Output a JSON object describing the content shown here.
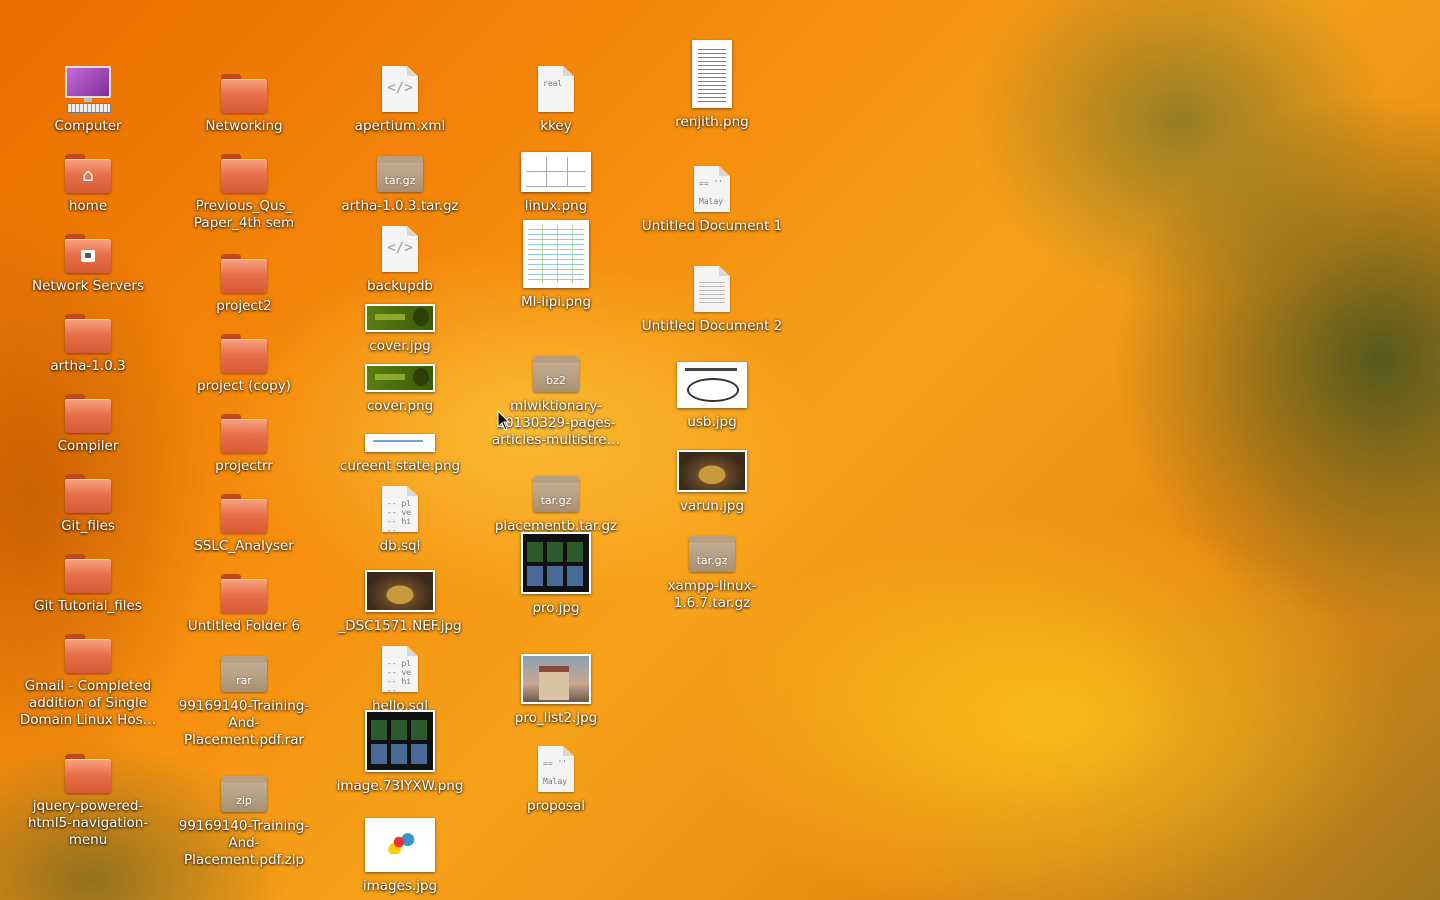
{
  "desktop": {
    "icons": [
      {
        "label": "Computer",
        "type": "computer"
      },
      {
        "label": "home",
        "type": "folder",
        "symbol": "home-icon"
      },
      {
        "label": "Network Servers",
        "type": "folder",
        "symbol": "network-icon"
      },
      {
        "label": "artha-1.0.3",
        "type": "folder"
      },
      {
        "label": "Compiler",
        "type": "folder"
      },
      {
        "label": "Git_files",
        "type": "folder"
      },
      {
        "label": "Git Tutorial_files",
        "type": "folder"
      },
      {
        "label": "Gmail - Completed addition of Single Domain Linux Hos…",
        "type": "folder"
      },
      {
        "label": "jquery-powered-html5-navigation-menu",
        "type": "folder"
      },
      {
        "label": "Networking",
        "type": "folder"
      },
      {
        "label": "Previous_Qus_ Paper_4th sem",
        "type": "folder"
      },
      {
        "label": "project2",
        "type": "folder"
      },
      {
        "label": "project (copy)",
        "type": "folder"
      },
      {
        "label": "projectrr",
        "type": "folder"
      },
      {
        "label": "SSLC_Analyser",
        "type": "folder"
      },
      {
        "label": "Untitled Folder 6",
        "type": "folder"
      },
      {
        "label": "99169140-Training-And-Placement.pdf.rar",
        "type": "archive",
        "ext": "rar"
      },
      {
        "label": "99169140-Training-And-Placement.pdf.zip",
        "type": "archive",
        "ext": "zip"
      },
      {
        "label": "apertium.xml",
        "type": "code"
      },
      {
        "label": "artha-1.0.3.tar.gz",
        "type": "archive",
        "ext": "tar.gz"
      },
      {
        "label": "backupdb",
        "type": "code"
      },
      {
        "label": "cover.jpg",
        "type": "thumb-cover"
      },
      {
        "label": "cover.png",
        "type": "thumb-cover"
      },
      {
        "label": "cureent state.png",
        "type": "thumb-state"
      },
      {
        "label": "db.sql",
        "type": "text",
        "preview": "-- pl\n-- ve\n-- hi\n--"
      },
      {
        "label": "_DSC1571.NEF.jpg",
        "type": "thumb-cake"
      },
      {
        "label": "hello.sql",
        "type": "text",
        "preview": "-- pl\n-- ve\n-- hi\n--"
      },
      {
        "label": "image.73IYXW.png",
        "type": "thumb-dark"
      },
      {
        "label": "images.jpg",
        "type": "thumb-bday"
      },
      {
        "label": "kkey",
        "type": "text",
        "preview": "real"
      },
      {
        "label": "linux.png",
        "type": "thumb-linux"
      },
      {
        "label": "Ml-lipi.png",
        "type": "thumb-table"
      },
      {
        "label": "mlwiktionary-20130329-pages-articles-multistre…",
        "type": "archive",
        "ext": "bz2"
      },
      {
        "label": "placementb.tar.gz",
        "type": "archive",
        "ext": "tar.gz"
      },
      {
        "label": "pro.jpg",
        "type": "thumb-dark"
      },
      {
        "label": "pro_list2.jpg",
        "type": "thumb-house"
      },
      {
        "label": "proposal",
        "type": "text",
        "preview": "== ''\n\nMalay"
      },
      {
        "label": "renjith.png",
        "type": "thumb-page"
      },
      {
        "label": "Untitled Document 1",
        "type": "text",
        "preview": "== ''\n\nMalay"
      },
      {
        "label": "Untitled Document 2",
        "type": "lines"
      },
      {
        "label": "usb.jpg",
        "type": "thumb-usb"
      },
      {
        "label": "varun.jpg",
        "type": "thumb-cake"
      },
      {
        "label": "xampp-linux-1.6.7.tar.gz",
        "type": "archive",
        "ext": "tar.gz"
      }
    ]
  },
  "colors": {
    "folder": "#e8704a",
    "label_text": "#ffffff"
  }
}
